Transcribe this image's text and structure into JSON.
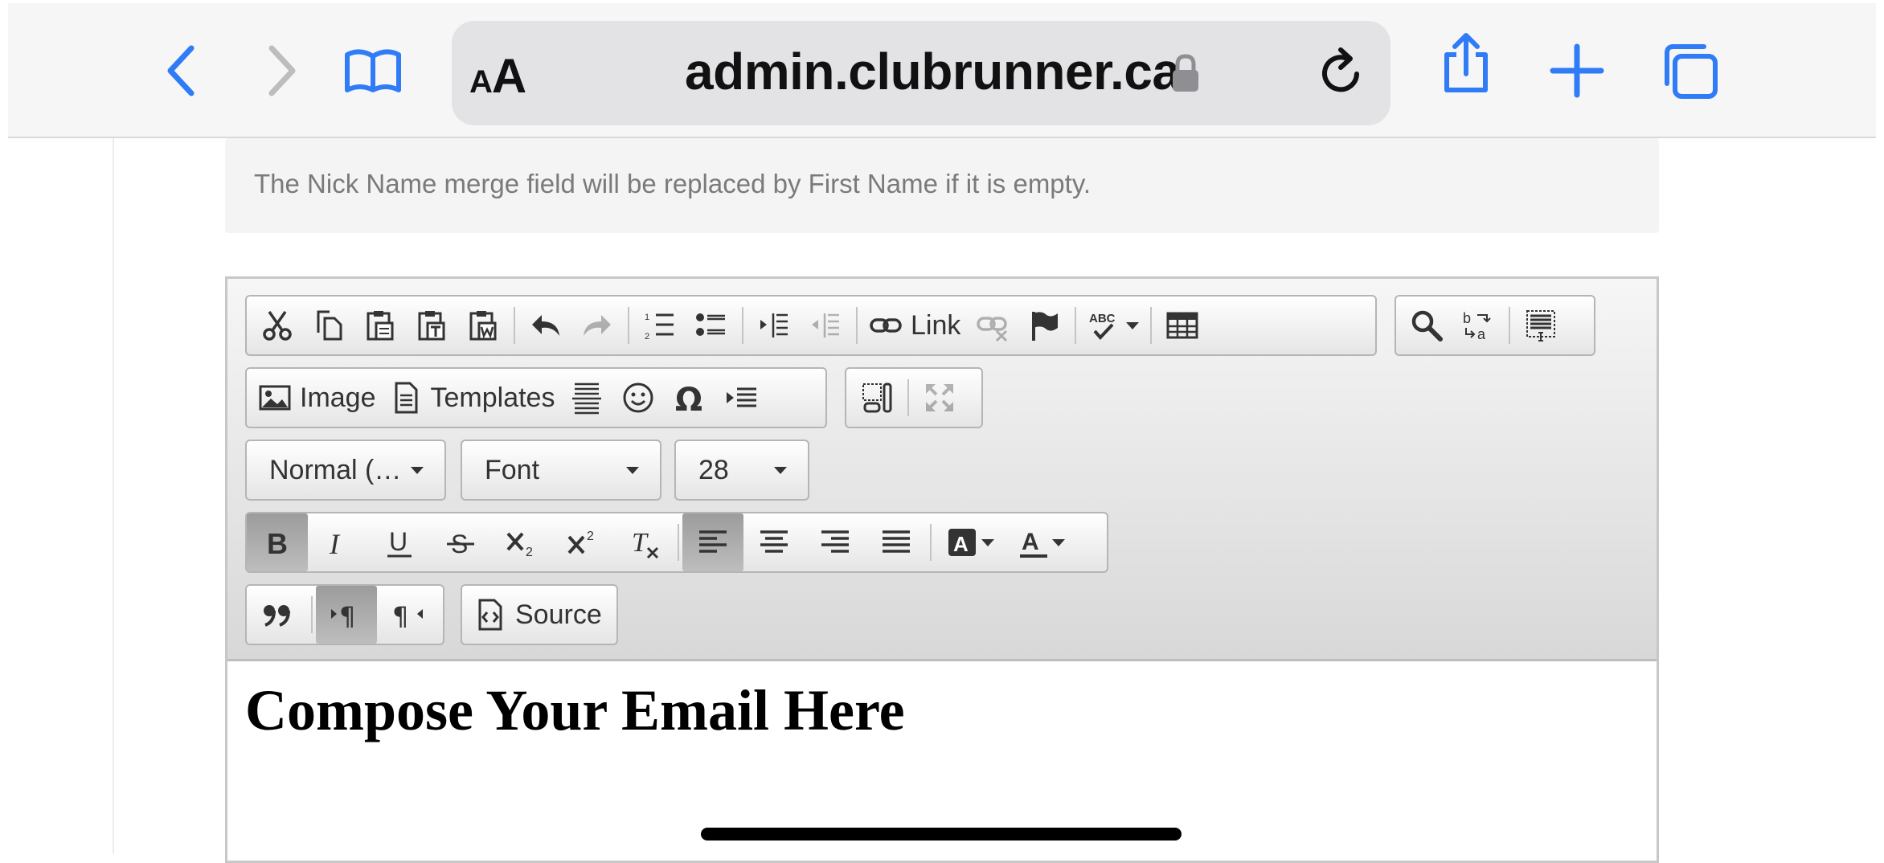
{
  "browser": {
    "address": "admin.clubrunner.ca",
    "text_size_label": "AA",
    "icons": [
      "back-icon",
      "forward-icon",
      "bookmarks-icon",
      "lock-icon",
      "reload-icon",
      "share-icon",
      "plus-icon",
      "tabs-icon"
    ]
  },
  "notice": {
    "text": "The Nick Name merge field will be replaced by First Name if it is empty."
  },
  "toolbar": {
    "link_label": "Link",
    "image_label": "Image",
    "templates_label": "Templates",
    "format_value": "Normal (…",
    "font_value": "Font",
    "size_value": "28",
    "source_label": "Source"
  },
  "editor": {
    "heading": "Compose Your Email Here"
  },
  "colors": {
    "accent": "#2f7cf6",
    "toolbar_bg": "#e4e4e4"
  }
}
